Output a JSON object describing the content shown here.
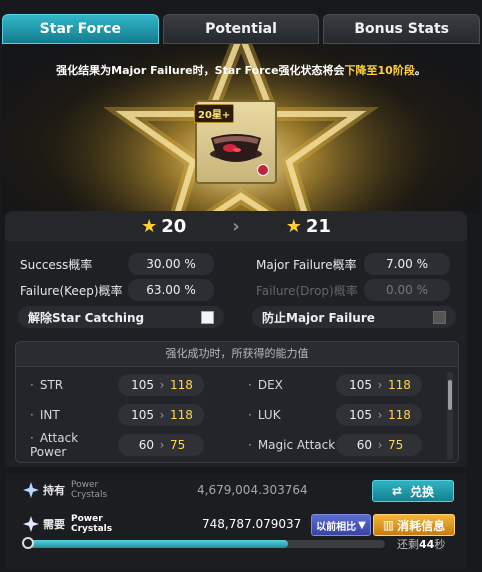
{
  "tabs": [
    {
      "label": "Star Force",
      "active": true
    },
    {
      "label": "Potential",
      "active": false
    },
    {
      "label": "Bonus Stats",
      "active": false
    }
  ],
  "notice": {
    "prefix": "强化结果为Major Failure时，Star Force强化状态将会",
    "highlight": "下降至10阶段",
    "suffix": "。"
  },
  "item": {
    "tag": "20星+",
    "icon": "dark-bowl-hat-icon"
  },
  "stars": {
    "current": "20",
    "next": "21"
  },
  "rates": {
    "success_label": "Success概率",
    "success_value": "30.00 %",
    "major_failure_label": "Major Failure概率",
    "major_failure_value": "7.00 %",
    "failure_keep_label": "Failure(Keep)概率",
    "failure_keep_value": "63.00 %",
    "failure_drop_label": "Failure(Drop)概率",
    "failure_drop_value": "0.00 %"
  },
  "toggles": {
    "star_catching_label": "解除Star Catching",
    "star_catching_checked": false,
    "prevent_major_label": "防止Major Failure",
    "prevent_major_checked": false
  },
  "stats": {
    "title": "强化成功时，所获得的能力值",
    "rows": [
      {
        "name": "STR",
        "current": "105",
        "next": "118"
      },
      {
        "name": "DEX",
        "current": "105",
        "next": "118"
      },
      {
        "name": "INT",
        "current": "105",
        "next": "118"
      },
      {
        "name": "LUK",
        "current": "105",
        "next": "118"
      },
      {
        "name": "Attack Power",
        "current": "60",
        "next": "75"
      },
      {
        "name": "Magic Attack",
        "current": "60",
        "next": "75"
      }
    ]
  },
  "crystals": {
    "owned_label": "持有",
    "owned_sub1": "Power",
    "owned_sub2": "Crystals",
    "owned_value": "4,679,004.303764",
    "exchange_label": "兑换",
    "required_label": "需要",
    "required_sub1": "Power",
    "required_sub2": "Crystals",
    "required_value": "748,787.079037",
    "compare_label": "以前相比",
    "consume_label": "消耗信息"
  },
  "timer": {
    "progress": 0.73,
    "prefix": "还剩",
    "seconds": "44",
    "suffix": "秒"
  },
  "colors": {
    "accent": "#1fa0b2",
    "gold": "#ffd033",
    "highlight": "#ffd23a"
  }
}
